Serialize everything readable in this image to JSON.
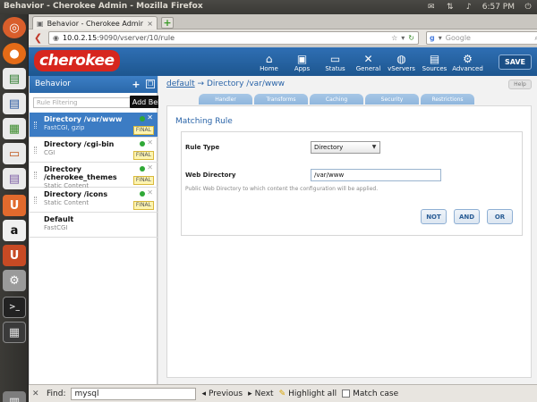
{
  "system": {
    "window_title": "Behavior - Cherokee Admin - Mozilla Firefox",
    "clock": "6:57 PM"
  },
  "browser": {
    "tab_title": "Behavior - Cherokee Admin",
    "url_host": "10.0.2.15",
    "url_path": ":9090/vserver/10/rule",
    "search_placeholder": "Google"
  },
  "header": {
    "logo": "cherokee",
    "nav": [
      {
        "label": "Home",
        "icon": "house-icon"
      },
      {
        "label": "Apps",
        "icon": "apps-icon"
      },
      {
        "label": "Status",
        "icon": "monitor-icon"
      },
      {
        "label": "General",
        "icon": "tools-icon"
      },
      {
        "label": "vServers",
        "icon": "globe-icon"
      },
      {
        "label": "Sources",
        "icon": "box-icon"
      },
      {
        "label": "Advanced",
        "icon": "gear-icon"
      }
    ],
    "save_label": "SAVE"
  },
  "sidebar": {
    "title": "Behavior",
    "filter_placeholder": "Rule Filtering",
    "tooltip": "Add Behavior Rule",
    "rules": [
      {
        "name": "Directory /var/www",
        "desc": "FastCGI, gzip",
        "final": "FINAL",
        "selected": true
      },
      {
        "name": "Directory /cgi-bin",
        "desc": "CGI",
        "final": "FINAL"
      },
      {
        "name": "Directory /cherokee_themes",
        "desc": "Static Content",
        "final": "FINAL"
      },
      {
        "name": "Directory /icons",
        "desc": "Static Content",
        "final": "FINAL"
      },
      {
        "name": "Default",
        "desc": "FastCGI"
      }
    ]
  },
  "main": {
    "breadcrumb_link": "default",
    "breadcrumb_rest": "→ Directory /var/www",
    "help": "Help",
    "tabs": [
      "Handler",
      "Transforms",
      "Caching",
      "Security",
      "Restrictions"
    ],
    "section_title": "Matching Rule",
    "rule_type_label": "Rule Type",
    "rule_type_value": "Directory",
    "web_dir_label": "Web Directory",
    "web_dir_value": "/var/www",
    "web_dir_hint": "Public Web Directory to which content the configuration will be applied.",
    "buttons": {
      "not": "NOT",
      "and": "AND",
      "or": "OR"
    }
  },
  "findbar": {
    "label": "Find:",
    "value": "mysql",
    "previous": "Previous",
    "next": "Next",
    "highlight": "Highlight all",
    "match_case": "Match case"
  }
}
